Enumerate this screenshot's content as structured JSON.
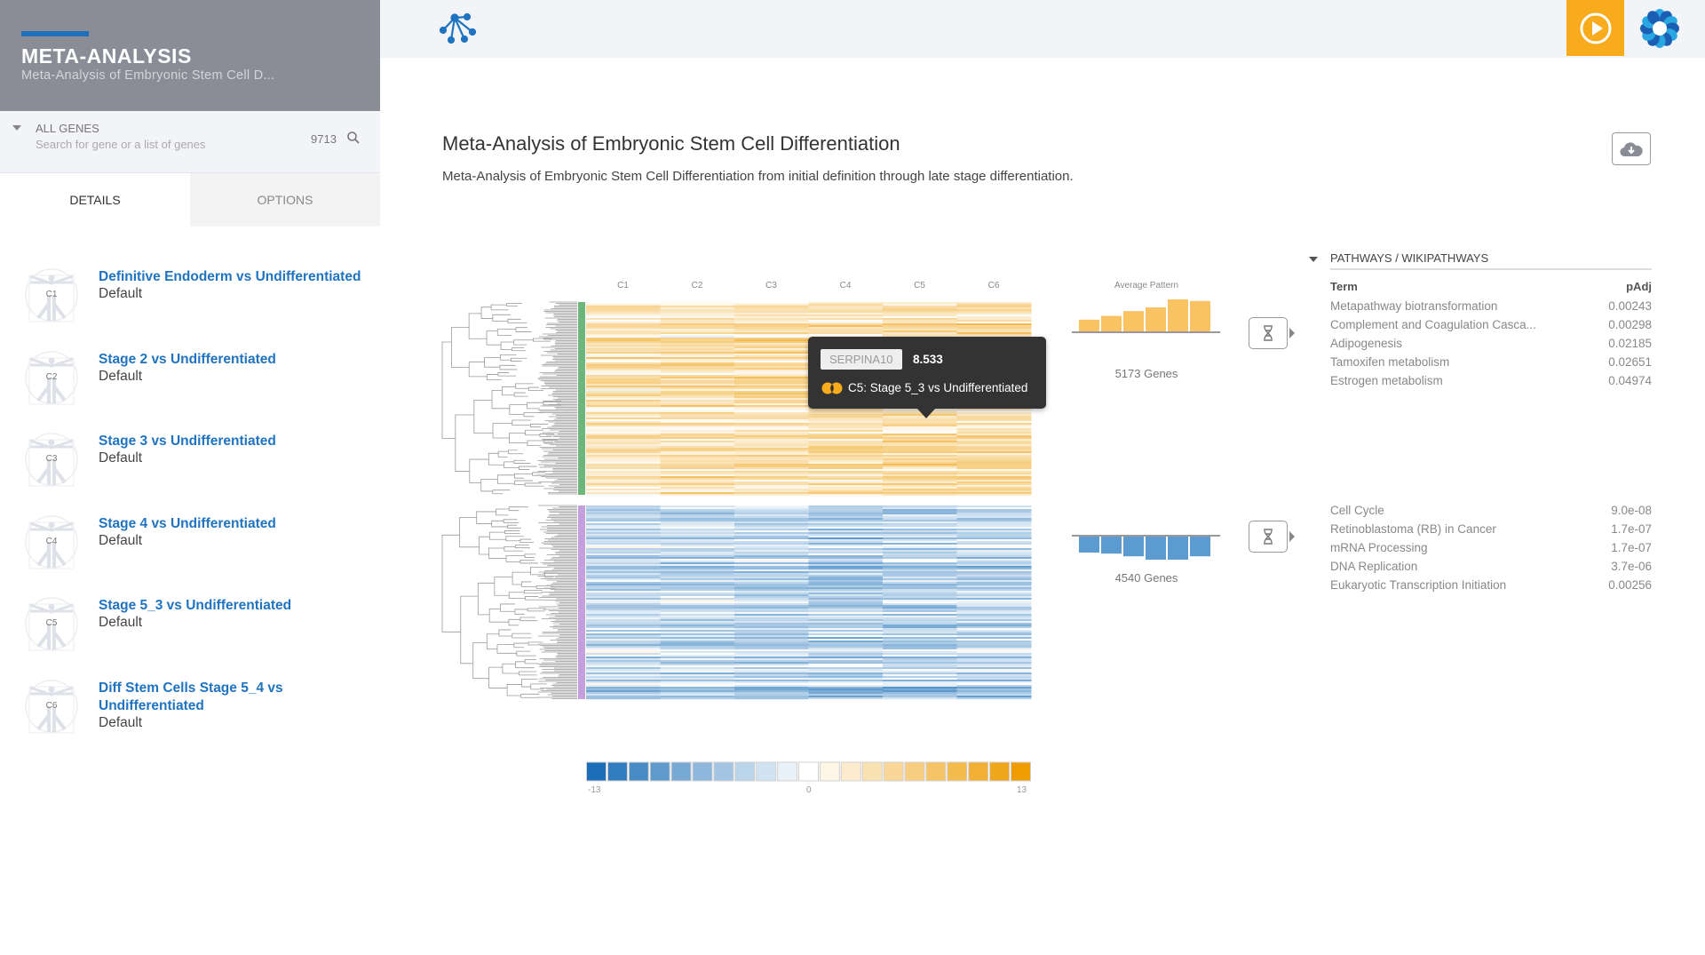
{
  "sidebar": {
    "title": "META-ANALYSIS",
    "subtitle": "Meta-Analysis of Embryonic Stem Cell D...",
    "search": {
      "label": "ALL GENES",
      "placeholder": "Search for gene or a list of genes",
      "count": "9713"
    },
    "tabs": [
      {
        "label": "DETAILS",
        "active": true
      },
      {
        "label": "OPTIONS",
        "active": false
      }
    ],
    "comparisons": [
      {
        "code": "C1",
        "title": "Definitive Endoderm vs Undifferentiated",
        "sub": "Default"
      },
      {
        "code": "C2",
        "title": "Stage 2 vs Undifferentiated",
        "sub": "Default"
      },
      {
        "code": "C3",
        "title": "Stage 3 vs Undifferentiated",
        "sub": "Default"
      },
      {
        "code": "C4",
        "title": "Stage 4 vs Undifferentiated",
        "sub": "Default"
      },
      {
        "code": "C5",
        "title": "Stage 5_3 vs Undifferentiated",
        "sub": "Default"
      },
      {
        "code": "C6",
        "title": "Diff Stem Cells Stage 5_4 vs Undifferentiated",
        "sub": "Default"
      }
    ]
  },
  "header": {
    "logo_icon": "network-tree-icon",
    "play_icon": "play-circle-icon",
    "brand_icon": "flower-logo-icon",
    "accent": "#f8ab1d"
  },
  "main": {
    "title": "Meta-Analysis of Embryonic Stem Cell Differentiation",
    "description": "Meta-Analysis of Embryonic Stem Cell Differentiation from initial definition through late stage differentiation.",
    "download_icon": "cloud-download-icon"
  },
  "heatmap": {
    "columns": [
      "C1",
      "C2",
      "C3",
      "C4",
      "C5",
      "C6"
    ],
    "clusters": [
      {
        "color": "#6db77b",
        "genes": "5173 Genes",
        "avg_pattern": [
          2.2,
          2.9,
          3.8,
          4.5,
          6.0,
          5.7
        ]
      },
      {
        "color": "#c4a0dd",
        "genes": "4540 Genes",
        "avg_pattern": [
          -3.0,
          -3.2,
          -3.7,
          -5.0,
          -4.5,
          -3.7
        ]
      }
    ],
    "avg_label": "Average Pattern",
    "colorbar": {
      "min": "-13",
      "mid": "0",
      "max": "13",
      "low_color": "#1a6fb8",
      "mid_color": "#ffffff",
      "high_color": "#ee9c00"
    }
  },
  "tooltip": {
    "gene": "SERPINA10",
    "value": "8.533",
    "comparison": "C5: Stage 5_3 vs Undifferentiated"
  },
  "pathways": {
    "title": "PATHWAYS / WIKIPATHWAYS",
    "col_term": "Term",
    "col_padj": "pAdj",
    "groups": [
      [
        {
          "term": "Metapathway biotransformation",
          "padj": "0.00243"
        },
        {
          "term": "Complement and Coagulation Casca...",
          "padj": "0.00298"
        },
        {
          "term": "Adipogenesis",
          "padj": "0.02185"
        },
        {
          "term": "Tamoxifen metabolism",
          "padj": "0.02651"
        },
        {
          "term": "Estrogen metabolism",
          "padj": "0.04974"
        }
      ],
      [
        {
          "term": "Cell Cycle",
          "padj": "9.0e-08"
        },
        {
          "term": "Retinoblastoma (RB) in Cancer",
          "padj": "1.7e-07"
        },
        {
          "term": "mRNA Processing",
          "padj": "1.7e-07"
        },
        {
          "term": "DNA Replication",
          "padj": "3.7e-06"
        },
        {
          "term": "Eukaryotic Transcription Initiation",
          "padj": "0.00256"
        }
      ]
    ]
  }
}
